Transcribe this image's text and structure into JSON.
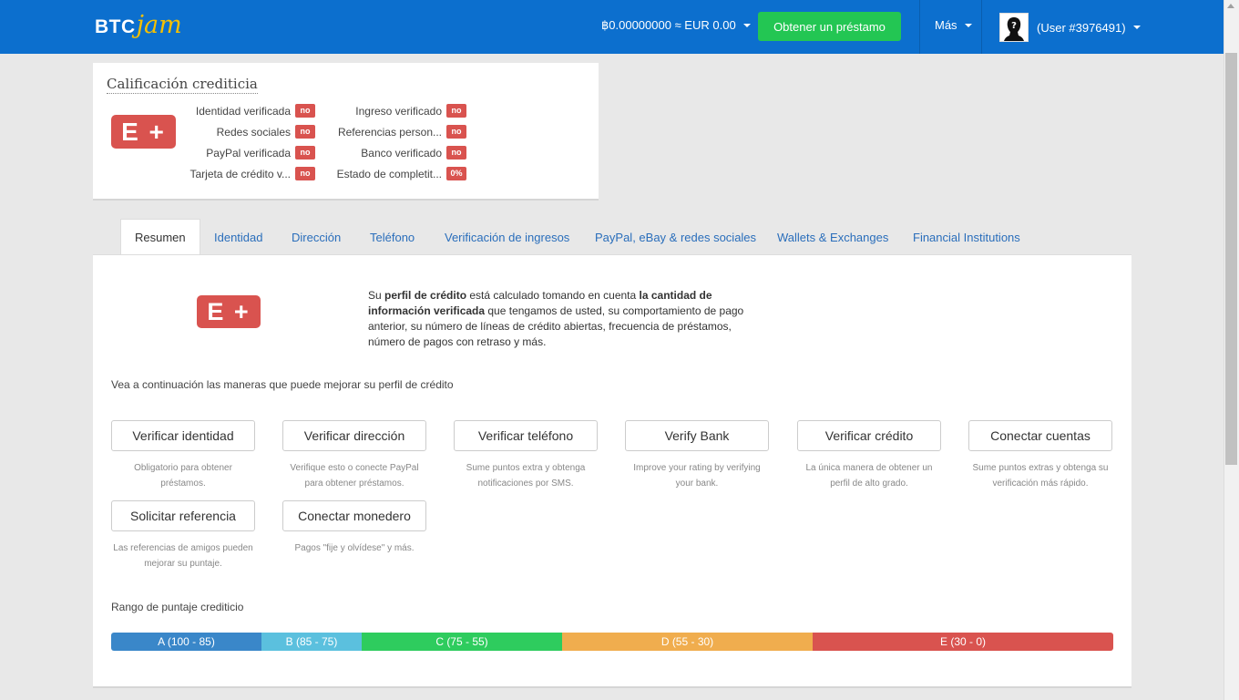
{
  "header": {
    "logo_btc": "BTC",
    "logo_jam": "jam",
    "balance": "฿0.00000000 ≈ EUR 0.00",
    "loan_button": "Obtener un préstamo",
    "more": "Más",
    "user": "(User #3976491)"
  },
  "credit": {
    "title": "Calificación crediticia",
    "grade": "E +",
    "left": [
      {
        "label": "Identidad verificada",
        "status": "no"
      },
      {
        "label": "Redes sociales",
        "status": "no"
      },
      {
        "label": "PayPal verificada",
        "status": "no"
      },
      {
        "label": "Tarjeta de crédito v...",
        "status": "no"
      }
    ],
    "right": [
      {
        "label": "Ingreso verificado",
        "status": "no"
      },
      {
        "label": "Referencias person...",
        "status": "no"
      },
      {
        "label": "Banco verificado",
        "status": "no"
      },
      {
        "label": "Estado de completit...",
        "status": "0%"
      }
    ]
  },
  "tabs": [
    {
      "label": "Resumen",
      "active": true
    },
    {
      "label": "Identidad"
    },
    {
      "label": "Dirección"
    },
    {
      "label": "Teléfono"
    },
    {
      "label": "Verificación de ingresos"
    },
    {
      "label": "PayPal, eBay & redes sociales"
    },
    {
      "label": "Wallets & Exchanges"
    },
    {
      "label": "Financial Institutions"
    }
  ],
  "main": {
    "grade": "E +",
    "summary": {
      "p1": "Su ",
      "b1": "perfil de crédito",
      "p2": " está calculado tomando en cuenta ",
      "b2": "la cantidad de información verificada",
      "p3": " que tengamos de usted, su comportamiento de pago anterior, su número de líneas de crédito abiertas, frecuencia de préstamos, número de pagos con retraso y más."
    },
    "improve_text": "Vea a continuación las maneras que puede mejorar su perfil de crédito",
    "actions": [
      {
        "label": "Verificar identidad",
        "desc": "Obligatorio para obtener préstamos."
      },
      {
        "label": "Verificar dirección",
        "desc": "Verifique esto o conecte PayPal para obtener préstamos."
      },
      {
        "label": "Verificar teléfono",
        "desc": "Sume puntos extra y obtenga notificaciones por SMS."
      },
      {
        "label": "Verify Bank",
        "desc": "Improve your rating by verifying your bank."
      },
      {
        "label": "Verificar crédito",
        "desc": "La única manera de obtener un perfil de alto grado."
      },
      {
        "label": "Conectar cuentas",
        "desc": "Sume puntos extras y obtenga su verificación más rápido."
      },
      {
        "label": "Solicitar referencia",
        "desc": "Las referencias de amigos pueden mejorar su puntaje."
      },
      {
        "label": "Conectar monedero",
        "desc": "Pagos \"fije y olvídese\" y más."
      }
    ],
    "range_label": "Rango de puntaje crediticio",
    "ranges": [
      {
        "label": "A (100 - 85)",
        "color": "#3a87c9",
        "high": 100,
        "low": 85
      },
      {
        "label": "B (85 - 75)",
        "color": "#5bc0de",
        "high": 85,
        "low": 75
      },
      {
        "label": "C (75 - 55)",
        "color": "#2ecc5e",
        "high": 75,
        "low": 55
      },
      {
        "label": "D (55 - 30)",
        "color": "#f0ad4e",
        "high": 55,
        "low": 30
      },
      {
        "label": "E (30 - 0)",
        "color": "#d9534f",
        "high": 30,
        "low": 0
      }
    ]
  }
}
